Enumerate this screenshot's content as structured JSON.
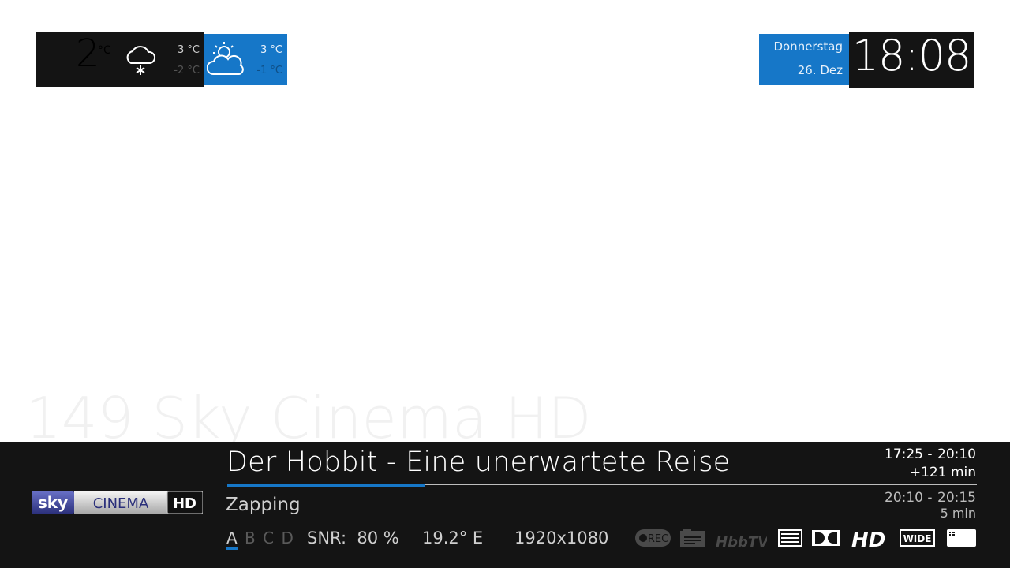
{
  "weather": {
    "current": {
      "temp": "2",
      "unit": "°C",
      "high": "3 °C",
      "low": "-2 °C",
      "icon": "snow-cloud-icon"
    },
    "forecast": {
      "high": "3 °C",
      "low": "-1 °C",
      "icon": "partly-cloudy-icon"
    }
  },
  "datetime": {
    "weekday": "Donnerstag",
    "date": "26. Dez",
    "time": "18:08"
  },
  "channel": {
    "number_name": "149 Sky Cinema HD"
  },
  "logo": {
    "text1": "sky",
    "text2": "CINEMA",
    "text3": "HD"
  },
  "now": {
    "title": "Der Hobbit - Eine unerwartete Reise",
    "start": "17:25  -",
    "end": "20:10",
    "remaining": "+121 min",
    "progress": 0.264
  },
  "next": {
    "title": "Zapping",
    "start": "20:10  -",
    "end": "20:15",
    "duration": "5 min"
  },
  "tuners": [
    "A",
    "B",
    "C",
    "D"
  ],
  "signal": {
    "snr": "SNR:  80 %",
    "orbit": "19.2° E",
    "resolution": "1920x1080"
  },
  "flags": {
    "rec": "REC",
    "hbbtv": "HbbTV",
    "hd": "HD",
    "wide": "WIDE"
  },
  "colors": {
    "accent": "#1677c8",
    "panel": "#141414"
  }
}
